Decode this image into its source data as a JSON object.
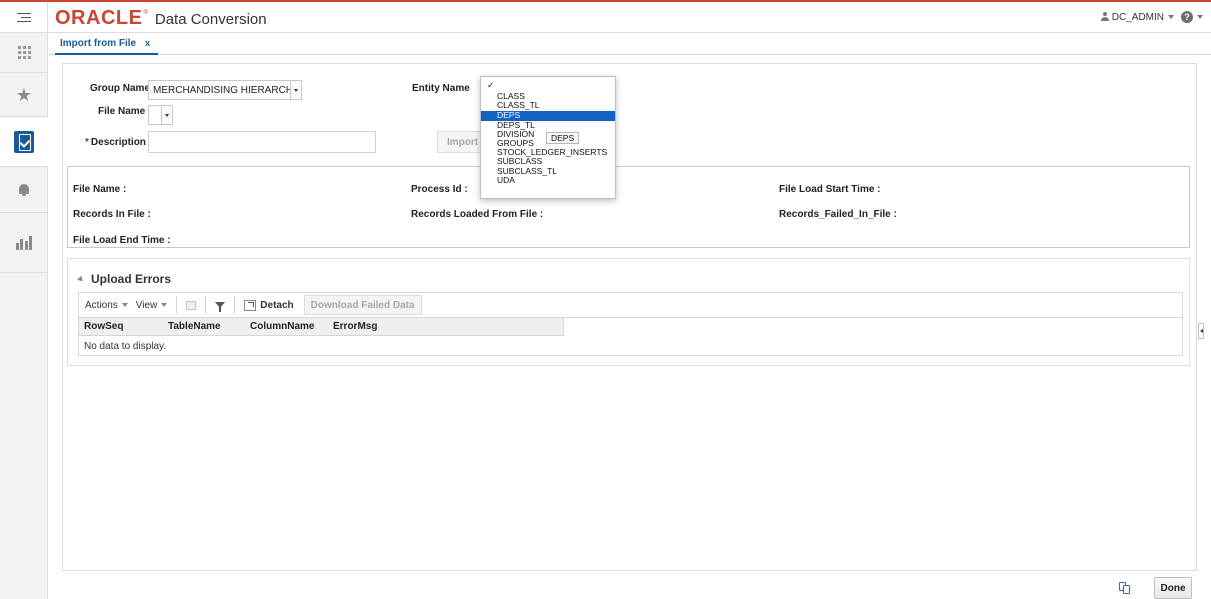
{
  "header": {
    "logo": "ORACLE",
    "app_title": "Data Conversion",
    "user": "DC_ADMIN",
    "help_glyph": "?"
  },
  "sidebar": {
    "items": [
      {
        "icon": "grid-icon"
      },
      {
        "icon": "star-icon"
      },
      {
        "icon": "tasks-icon",
        "active": true
      },
      {
        "icon": "bell-icon"
      },
      {
        "icon": "bar-chart-icon"
      }
    ]
  },
  "tab": {
    "label": "Import from File",
    "close": "x"
  },
  "form": {
    "group_name_label": "Group Name",
    "group_name_value": "MERCHANDISING HIERARCHY",
    "file_name_label": "File Name",
    "file_name_value": "",
    "description_label": "Description",
    "required_mark": "*",
    "description_value": "",
    "entity_name_label": "Entity Name",
    "import_button": "Import Data"
  },
  "entity_dropdown": {
    "check": "✓",
    "options": [
      "CLASS",
      "CLASS_TL",
      "DEPS",
      "DEPS_TL",
      "DIVISION",
      "GROUPS",
      "STOCK_LEDGER_INSERTS",
      "SUBCLASS",
      "SUBCLASS_TL",
      "UDA"
    ],
    "selected": "DEPS",
    "tooltip": "DEPS"
  },
  "info": {
    "file_name": "File Name :",
    "process_id": "Process Id :",
    "file_load_start_time": "File Load Start Time :",
    "records_in_file": "Records In File :",
    "records_loaded": "Records Loaded From File :",
    "records_failed": "Records_Failed_In_File :",
    "file_load_end_time": "File Load End Time :"
  },
  "upload_errors": {
    "title": "Upload Errors",
    "toolbar": {
      "actions": "Actions",
      "view": "View",
      "detach": "Detach",
      "download_failed": "Download Failed Data"
    },
    "columns": [
      "RowSeq",
      "TableName",
      "ColumnName",
      "ErrorMsg"
    ],
    "empty_text": "No data to display."
  },
  "footer": {
    "done": "Done"
  },
  "colors": {
    "oracle_red": "#c74634",
    "accent_blue": "#1b5a96",
    "selection_blue": "#1461c4"
  }
}
